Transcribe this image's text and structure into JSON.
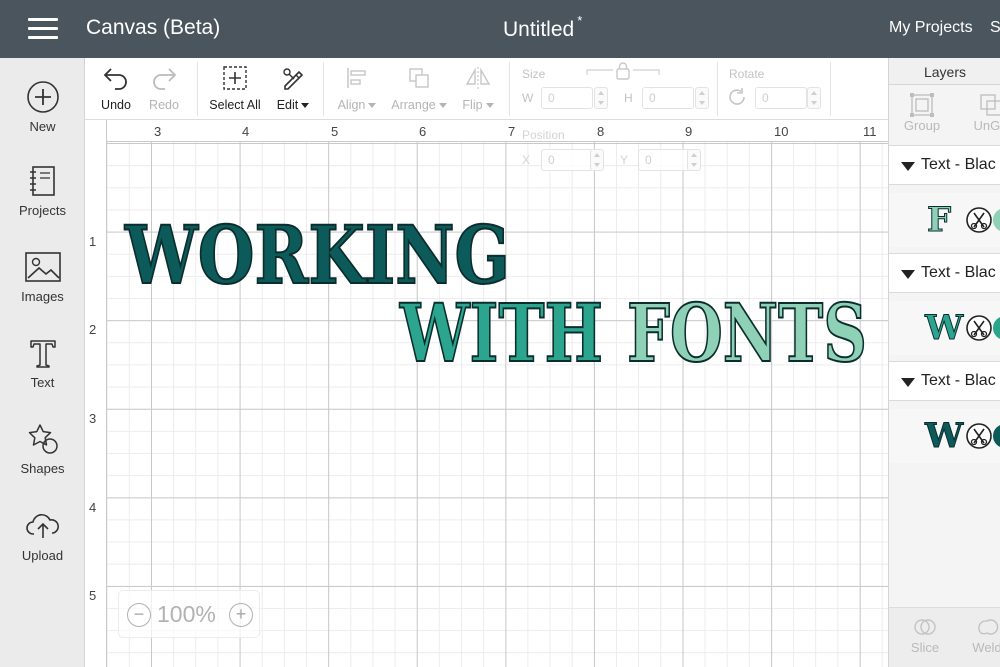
{
  "topbar": {
    "app_title": "Canvas (Beta)",
    "doc_title": "Untitled",
    "unsaved_marker": "*",
    "my_projects": "My Projects",
    "save_partial": "S"
  },
  "sidebar": {
    "items": [
      {
        "label": "New",
        "icon": "plus-circle-icon"
      },
      {
        "label": "Projects",
        "icon": "notebook-icon"
      },
      {
        "label": "Images",
        "icon": "image-icon"
      },
      {
        "label": "Text",
        "icon": "text-t-icon"
      },
      {
        "label": "Shapes",
        "icon": "shapes-icon"
      },
      {
        "label": "Upload",
        "icon": "cloud-upload-icon"
      }
    ]
  },
  "toolbar": {
    "undo": "Undo",
    "redo": "Redo",
    "select_all": "Select All",
    "edit": "Edit",
    "align": "Align",
    "arrange": "Arrange",
    "flip": "Flip",
    "size_label": "Size",
    "w_label": "W",
    "h_label": "H",
    "w_value": "0",
    "h_value": "0",
    "rotate_label": "Rotate",
    "rotate_value": "0",
    "position_label": "Position",
    "x_label": "X",
    "y_label": "Y",
    "x_value": "0",
    "y_value": "0"
  },
  "ruler": {
    "top_numbers": [
      "3",
      "4",
      "5",
      "6",
      "7",
      "8",
      "9",
      "10",
      "11"
    ],
    "left_numbers": [
      "1",
      "2",
      "3",
      "4",
      "5"
    ]
  },
  "canvas": {
    "line1": "WORKING",
    "line2_a": "WITH",
    "line2_b": "FONTS",
    "colors": {
      "dark_teal": "#0d5a5a",
      "mid_teal": "#2ba58e",
      "light_teal": "#8fd1b6",
      "outline": "#0b2d2d"
    }
  },
  "zoom": {
    "value": "100%",
    "minus": "−",
    "plus": "+"
  },
  "layers": {
    "title": "Layers",
    "group": "Group",
    "ungroup_partial": "UnGr",
    "rows": [
      {
        "name": "Text - Blac",
        "glyph": "F",
        "glyph_color": "#8fd1b6",
        "dot_color": "#8fd1b6"
      },
      {
        "name": "Text - Blac",
        "glyph": "W",
        "glyph_color": "#2ba58e",
        "dot_color": "#2ba58e"
      },
      {
        "name": "Text - Blac",
        "glyph": "W",
        "glyph_color": "#0d5a5a",
        "dot_color": "#0d5a5a"
      }
    ],
    "slice": "Slice",
    "weld_partial": "Weld"
  }
}
